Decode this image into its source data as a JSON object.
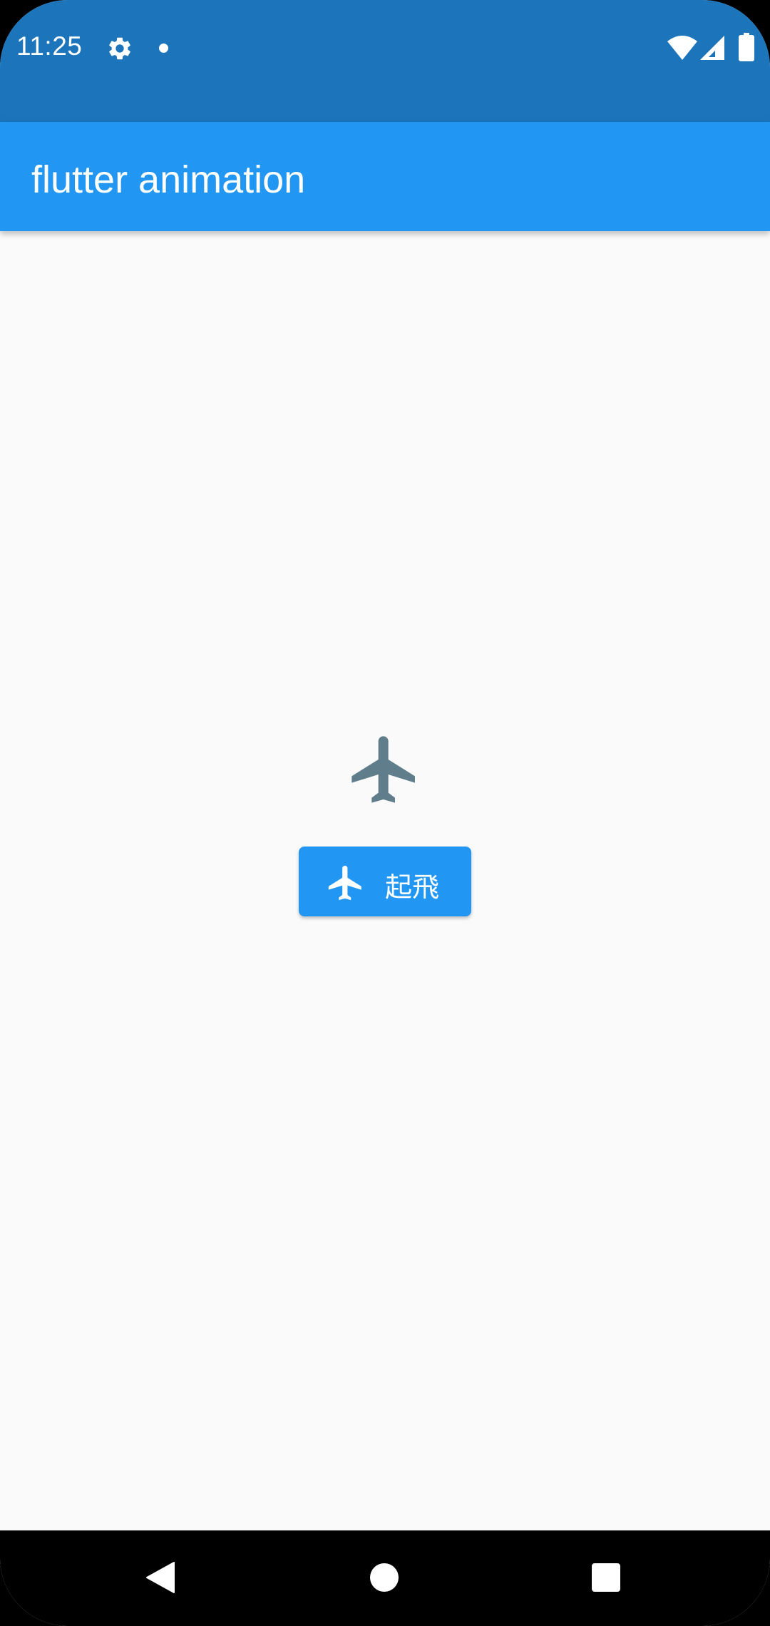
{
  "status_bar": {
    "time": "11:25",
    "icons": [
      "settings-gear-icon",
      "notification-dot-icon",
      "wifi-icon",
      "cell-signal-icon",
      "battery-icon"
    ],
    "background_color": "#1c74bb"
  },
  "app_bar": {
    "title": "flutter animation",
    "background_color": "#2196f3"
  },
  "main": {
    "plane_icon": "airplane-icon",
    "plane_icon_color": "#607d8b",
    "fly_button": {
      "icon": "airplane-icon",
      "label": "起飛",
      "background_color": "#2196f3"
    }
  },
  "nav_bar": {
    "buttons": [
      "back-icon",
      "home-icon",
      "recents-icon"
    ]
  }
}
